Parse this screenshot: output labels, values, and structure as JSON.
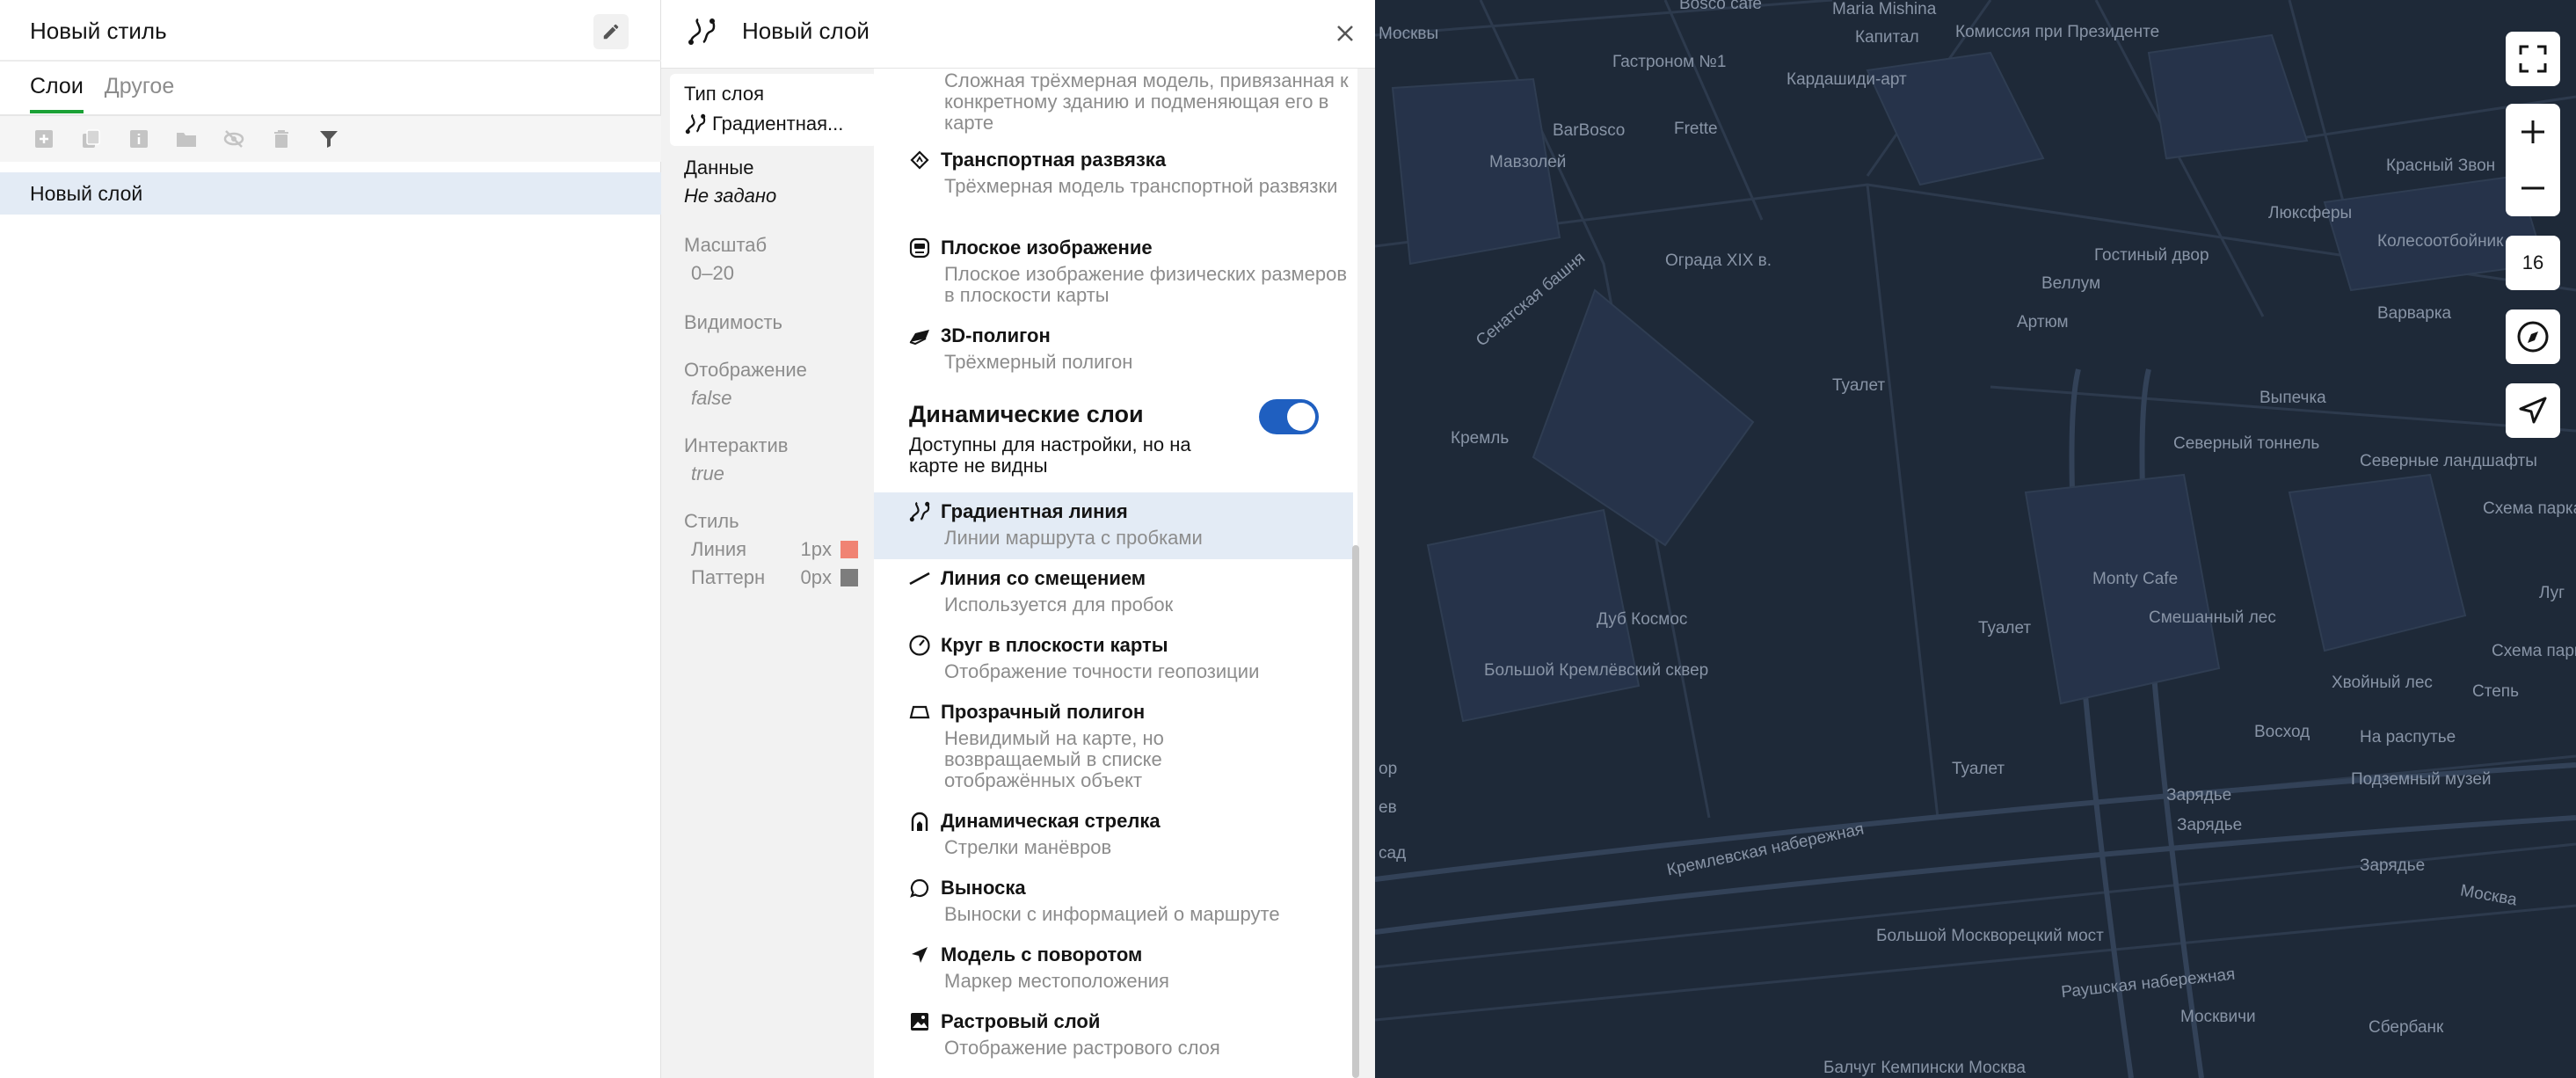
{
  "style_panel": {
    "title": "Новый стиль",
    "tabs": [
      {
        "label": "Слои",
        "active": true
      },
      {
        "label": "Другое",
        "active": false
      }
    ],
    "toolbar_icons": [
      "add-layer-icon",
      "copy-icon",
      "info-icon",
      "folder-icon",
      "hide-icon",
      "delete-icon",
      "filter-icon"
    ],
    "layers": [
      {
        "label": "Новый слой",
        "selected": true
      }
    ]
  },
  "layer_editor": {
    "title": "Новый слой",
    "properties": {
      "type": {
        "label": "Тип слоя",
        "value": "Градиентная..."
      },
      "data": {
        "label": "Данные",
        "value": "Не задано"
      },
      "scale": {
        "label": "Масштаб",
        "value": "0–20"
      },
      "visibility": {
        "label": "Видимость"
      },
      "display": {
        "label": "Отображение",
        "value": "false"
      },
      "interactive": {
        "label": "Интерактив",
        "value": "true"
      },
      "style": {
        "label": "Стиль",
        "rows": [
          {
            "name": "Линия",
            "value": "1px",
            "color": "#f08373"
          },
          {
            "name": "Паттерн",
            "value": "0px",
            "color": "#7d7d7d"
          }
        ]
      }
    },
    "types_list": {
      "top_partial_desc": "Сложная трёхмерная модель, привязанная к конкретному зданию и подменяющая его в карте",
      "static_items": [
        {
          "title": "Транспортная развязка",
          "desc": "Трёхмерная модель транспортной развязки",
          "icon": "diamond-icon"
        },
        {
          "title": "Плоское изображение",
          "desc": "Плоское изображение физических размеров в плоскости карты",
          "icon": "image-plane-icon"
        },
        {
          "title": "3D-полигон",
          "desc": "Трёхмерный полигон",
          "icon": "polygon-3d-icon"
        }
      ],
      "dynamic_section": {
        "title": "Динамические слои",
        "desc": "Доступны для настройки, но на карте не видны",
        "toggle_on": true
      },
      "dynamic_items": [
        {
          "title": "Градиентная линия",
          "desc": "Линии маршрута с пробками",
          "icon": "gradient-line-icon",
          "selected": true
        },
        {
          "title": "Линия со смещением",
          "desc": "Используется для пробок",
          "icon": "offset-line-icon"
        },
        {
          "title": "Круг в плоскости карты",
          "desc": "Отображение точности геопозиции",
          "icon": "circle-gauge-icon"
        },
        {
          "title": "Прозрачный полигон",
          "desc": "Невидимый на карте, но возвращаемый в списке отображённых объект",
          "icon": "transparent-polygon-icon"
        },
        {
          "title": "Динамическая стрелка",
          "desc": "Стрелки манёвров",
          "icon": "dynamic-arrow-icon"
        },
        {
          "title": "Выноска",
          "desc": "Выноски с информацией о маршруте",
          "icon": "callout-icon"
        },
        {
          "title": "Модель с поворотом",
          "desc": "Маркер местоположения",
          "icon": "location-arrow-icon"
        },
        {
          "title": "Растровый слой",
          "desc": "Отображение растрового слоя",
          "icon": "raster-icon"
        }
      ]
    }
  },
  "map": {
    "zoom_level": "16",
    "labels": [
      "Bosco cafe",
      "Maria Mishina",
      "Москвы",
      "Гастроном №1",
      "Капитал",
      "Комиссия при Президенте",
      "Кардашиди-арт",
      "BarBosco",
      "Frette",
      "Мавзолей",
      "Красный Звон",
      "Ограда XIX в.",
      "Люксферы",
      "Колесоотбойник",
      "Гостиный двор",
      "Веллум",
      "Варварка",
      "Артюм",
      "Туалет",
      "Выпечка",
      "Кремль",
      "Северный тоннель",
      "Северные ландшафты",
      "Схема парка",
      "Monty Cafe",
      "Смешанный лес",
      "Дуб Космос",
      "Большой Кремлёвский сквер",
      "Туалет",
      "Хвойный лес",
      "Восход",
      "Степь",
      "На распутье",
      "Туалет",
      "Зарядье",
      "Подземный музей",
      "Зарядье",
      "Кремлевская набережная",
      "Зарядье",
      "Москва",
      "Большой Москворецкий мост",
      "Раушская набережная",
      "Москвичи",
      "Сбербанк",
      "Балчуг Кемпински Москва",
      "Луг",
      "Схема парка",
      "Сенатская башня",
      "Туалет",
      "сад",
      "ев",
      "ор"
    ],
    "controls": [
      "fullscreen-icon",
      "zoom-in-icon",
      "zoom-out-icon",
      "zoom-level",
      "compass-icon",
      "geolocation-icon"
    ]
  }
}
